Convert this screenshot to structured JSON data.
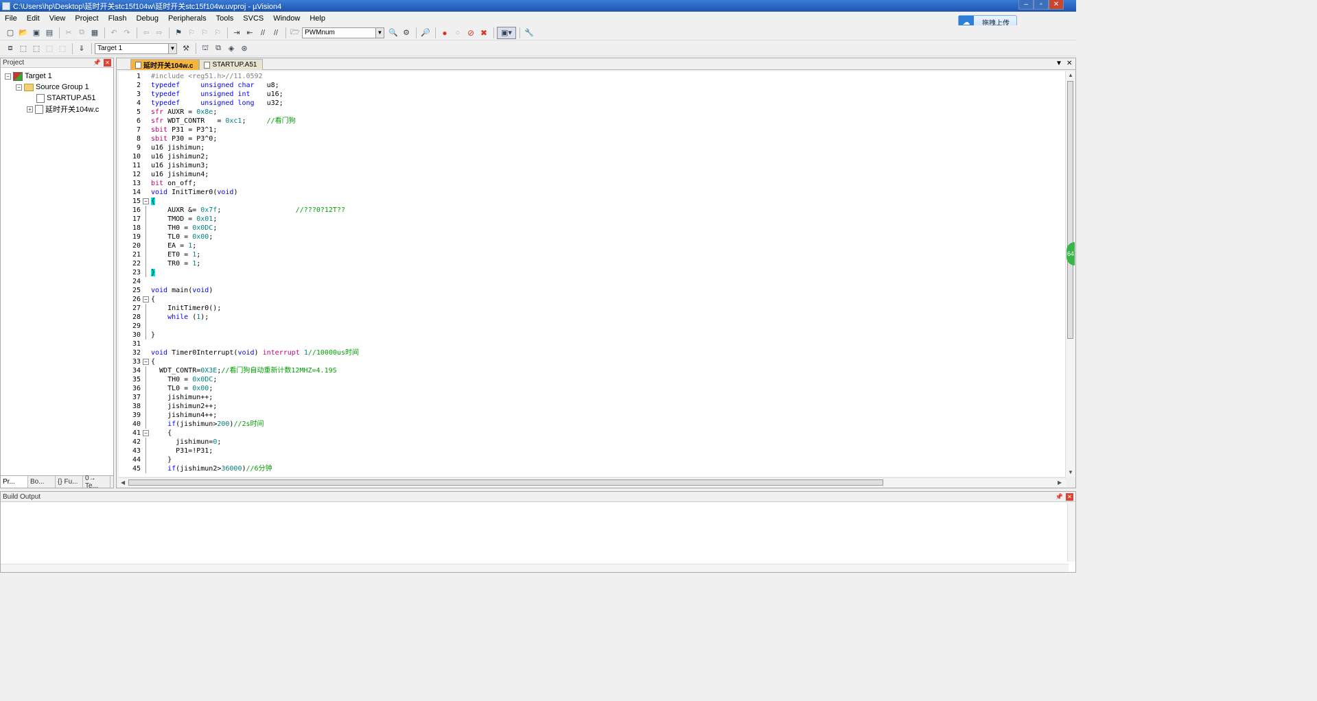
{
  "window": {
    "title": "C:\\Users\\hp\\Desktop\\延时开关stc15f104w\\延时开关stc15f104w.uvproj - µVision4",
    "minimize": "–",
    "maximize": "▫",
    "close": "✕"
  },
  "menu": [
    "File",
    "Edit",
    "View",
    "Project",
    "Flash",
    "Debug",
    "Peripherals",
    "Tools",
    "SVCS",
    "Window",
    "Help"
  ],
  "upload_button": {
    "label": "拖拽上传",
    "icon": "cloud-icon"
  },
  "toolbar1": {
    "find_combo_value": "PWMnum"
  },
  "toolbar2": {
    "target_combo_value": "Target 1"
  },
  "project_panel": {
    "title": "Project",
    "tree": [
      {
        "label": "Target 1",
        "level": 0,
        "expander": "−",
        "icon": "target-icon"
      },
      {
        "label": "Source Group 1",
        "level": 1,
        "expander": "−",
        "icon": "folder-icon"
      },
      {
        "label": "STARTUP.A51",
        "level": 2,
        "expander": "",
        "icon": "file-icon"
      },
      {
        "label": "延时开关104w.c",
        "level": 2,
        "expander": "+",
        "icon": "file-icon"
      }
    ],
    "bottom_tabs": [
      "Pr...",
      "Bo...",
      "{} Fu...",
      "0→ Te..."
    ]
  },
  "editor": {
    "tabs": [
      {
        "label": "延时开关104w.c",
        "active": true
      },
      {
        "label": "STARTUP.A51",
        "active": false
      }
    ],
    "badge": "64",
    "lines": [
      {
        "n": "1",
        "fold": "",
        "segs": [
          [
            "pp",
            "#include <reg51.h>//11.0592"
          ]
        ]
      },
      {
        "n": "2",
        "fold": "",
        "segs": [
          [
            "kw",
            "typedef     unsigned char   "
          ],
          [
            "",
            "u8;"
          ]
        ]
      },
      {
        "n": "3",
        "fold": "",
        "segs": [
          [
            "kw",
            "typedef     unsigned int    "
          ],
          [
            "",
            "u16;"
          ]
        ]
      },
      {
        "n": "4",
        "fold": "",
        "segs": [
          [
            "kw",
            "typedef     unsigned long   "
          ],
          [
            "",
            "u32;"
          ]
        ]
      },
      {
        "n": "5",
        "fold": "",
        "segs": [
          [
            "red",
            "sfr"
          ],
          [
            "",
            " AUXR = "
          ],
          [
            "num",
            "0x8e"
          ],
          [
            "",
            ";"
          ]
        ]
      },
      {
        "n": "6",
        "fold": "",
        "segs": [
          [
            "red",
            "sfr"
          ],
          [
            "",
            " WDT_CONTR   = "
          ],
          [
            "num",
            "0xc1"
          ],
          [
            "",
            ";     "
          ],
          [
            "cm",
            "//看门狗"
          ]
        ]
      },
      {
        "n": "7",
        "fold": "",
        "segs": [
          [
            "red",
            "sbit"
          ],
          [
            "",
            " P31 = P3^1;"
          ]
        ]
      },
      {
        "n": "8",
        "fold": "",
        "segs": [
          [
            "red",
            "sbit"
          ],
          [
            "",
            " P30 = P3^0;"
          ]
        ]
      },
      {
        "n": "9",
        "fold": "",
        "segs": [
          [
            "",
            "u16 jishimun;"
          ]
        ]
      },
      {
        "n": "10",
        "fold": "",
        "segs": [
          [
            "",
            "u16 jishimun2;"
          ]
        ]
      },
      {
        "n": "11",
        "fold": "",
        "segs": [
          [
            "",
            "u16 jishimun3;"
          ]
        ]
      },
      {
        "n": "12",
        "fold": "",
        "segs": [
          [
            "",
            "u16 jishimun4;"
          ]
        ]
      },
      {
        "n": "13",
        "fold": "",
        "segs": [
          [
            "red",
            "bit"
          ],
          [
            "",
            " on_off;"
          ]
        ]
      },
      {
        "n": "14",
        "fold": "",
        "segs": [
          [
            "kw",
            "void"
          ],
          [
            "",
            " InitTimer0("
          ],
          [
            "kw",
            "void"
          ],
          [
            "",
            ")"
          ]
        ]
      },
      {
        "n": "15",
        "fold": "−",
        "segs": [
          [
            "brace",
            "{"
          ]
        ]
      },
      {
        "n": "16",
        "fold": "|",
        "segs": [
          [
            "",
            "    AUXR &= "
          ],
          [
            "num",
            "0x7f"
          ],
          [
            "",
            ";                  "
          ],
          [
            "cm",
            "//???0?12T??"
          ]
        ]
      },
      {
        "n": "17",
        "fold": "|",
        "segs": [
          [
            "",
            "    TMOD = "
          ],
          [
            "num",
            "0x01"
          ],
          [
            "",
            ";"
          ]
        ]
      },
      {
        "n": "18",
        "fold": "|",
        "segs": [
          [
            "",
            "    TH0 = "
          ],
          [
            "num",
            "0x0DC"
          ],
          [
            "",
            ";"
          ]
        ]
      },
      {
        "n": "19",
        "fold": "|",
        "segs": [
          [
            "",
            "    TL0 = "
          ],
          [
            "num",
            "0x00"
          ],
          [
            "",
            ";"
          ]
        ]
      },
      {
        "n": "20",
        "fold": "|",
        "segs": [
          [
            "",
            "    EA = "
          ],
          [
            "num",
            "1"
          ],
          [
            "",
            ";"
          ]
        ]
      },
      {
        "n": "21",
        "fold": "|",
        "segs": [
          [
            "",
            "    ET0 = "
          ],
          [
            "num",
            "1"
          ],
          [
            "",
            ";"
          ]
        ]
      },
      {
        "n": "22",
        "fold": "|",
        "segs": [
          [
            "",
            "    TR0 = "
          ],
          [
            "num",
            "1"
          ],
          [
            "",
            ";"
          ]
        ]
      },
      {
        "n": "23",
        "fold": "|",
        "segs": [
          [
            "brace",
            "}"
          ]
        ]
      },
      {
        "n": "24",
        "fold": "",
        "segs": [
          [
            "",
            ""
          ]
        ]
      },
      {
        "n": "25",
        "fold": "",
        "segs": [
          [
            "kw",
            "void"
          ],
          [
            "",
            " main("
          ],
          [
            "kw",
            "void"
          ],
          [
            "",
            ")"
          ]
        ]
      },
      {
        "n": "26",
        "fold": "−",
        "segs": [
          [
            "",
            "{"
          ]
        ]
      },
      {
        "n": "27",
        "fold": "|",
        "segs": [
          [
            "",
            "    InitTimer0();"
          ]
        ]
      },
      {
        "n": "28",
        "fold": "|",
        "segs": [
          [
            "",
            "    "
          ],
          [
            "kw",
            "while"
          ],
          [
            "",
            " ("
          ],
          [
            "num",
            "1"
          ],
          [
            "",
            ");"
          ]
        ]
      },
      {
        "n": "29",
        "fold": "|",
        "segs": [
          [
            "",
            ""
          ]
        ]
      },
      {
        "n": "30",
        "fold": "|",
        "segs": [
          [
            "",
            "}"
          ]
        ]
      },
      {
        "n": "31",
        "fold": "",
        "segs": [
          [
            "",
            ""
          ]
        ]
      },
      {
        "n": "32",
        "fold": "",
        "segs": [
          [
            "kw",
            "void"
          ],
          [
            "",
            " Timer0Interrupt("
          ],
          [
            "kw",
            "void"
          ],
          [
            "",
            ") "
          ],
          [
            "red",
            "interrupt"
          ],
          [
            "",
            " "
          ],
          [
            "num",
            "1"
          ],
          [
            "cm",
            "//10000us时间"
          ]
        ]
      },
      {
        "n": "33",
        "fold": "−",
        "segs": [
          [
            "",
            "{"
          ]
        ]
      },
      {
        "n": "34",
        "fold": "|",
        "segs": [
          [
            "",
            "  WDT_CONTR="
          ],
          [
            "num",
            "0X3E"
          ],
          [
            "",
            ";"
          ],
          [
            "cm",
            "//看门狗自动重新计数12MHZ=4.19S"
          ]
        ]
      },
      {
        "n": "35",
        "fold": "|",
        "segs": [
          [
            "",
            "    TH0 = "
          ],
          [
            "num",
            "0x0DC"
          ],
          [
            "",
            ";"
          ]
        ]
      },
      {
        "n": "36",
        "fold": "|",
        "segs": [
          [
            "",
            "    TL0 = "
          ],
          [
            "num",
            "0x00"
          ],
          [
            "",
            ";"
          ]
        ]
      },
      {
        "n": "37",
        "fold": "|",
        "segs": [
          [
            "",
            "    jishimun++;"
          ]
        ]
      },
      {
        "n": "38",
        "fold": "|",
        "segs": [
          [
            "",
            "    jishimun2++;"
          ]
        ]
      },
      {
        "n": "39",
        "fold": "|",
        "segs": [
          [
            "",
            "    jishimun4++;"
          ]
        ]
      },
      {
        "n": "40",
        "fold": "|",
        "segs": [
          [
            "",
            "    "
          ],
          [
            "kw",
            "if"
          ],
          [
            "",
            "(jishimun>"
          ],
          [
            "num",
            "200"
          ],
          [
            "",
            ")"
          ],
          [
            "cm",
            "//2s时间"
          ]
        ]
      },
      {
        "n": "41",
        "fold": "−",
        "segs": [
          [
            "",
            "    {"
          ]
        ]
      },
      {
        "n": "42",
        "fold": "|",
        "segs": [
          [
            "",
            "      jishimun="
          ],
          [
            "num",
            "0"
          ],
          [
            "",
            ";"
          ]
        ]
      },
      {
        "n": "43",
        "fold": "|",
        "segs": [
          [
            "",
            "      P31=!P31;"
          ]
        ]
      },
      {
        "n": "44",
        "fold": "|",
        "segs": [
          [
            "",
            "    }"
          ]
        ]
      },
      {
        "n": "45",
        "fold": "|",
        "segs": [
          [
            "",
            "    "
          ],
          [
            "kw",
            "if"
          ],
          [
            "",
            "(jishimun2>"
          ],
          [
            "num",
            "36000"
          ],
          [
            "",
            ")"
          ],
          [
            "cm",
            "//6分钟"
          ]
        ]
      }
    ]
  },
  "build_output": {
    "title": "Build Output"
  }
}
